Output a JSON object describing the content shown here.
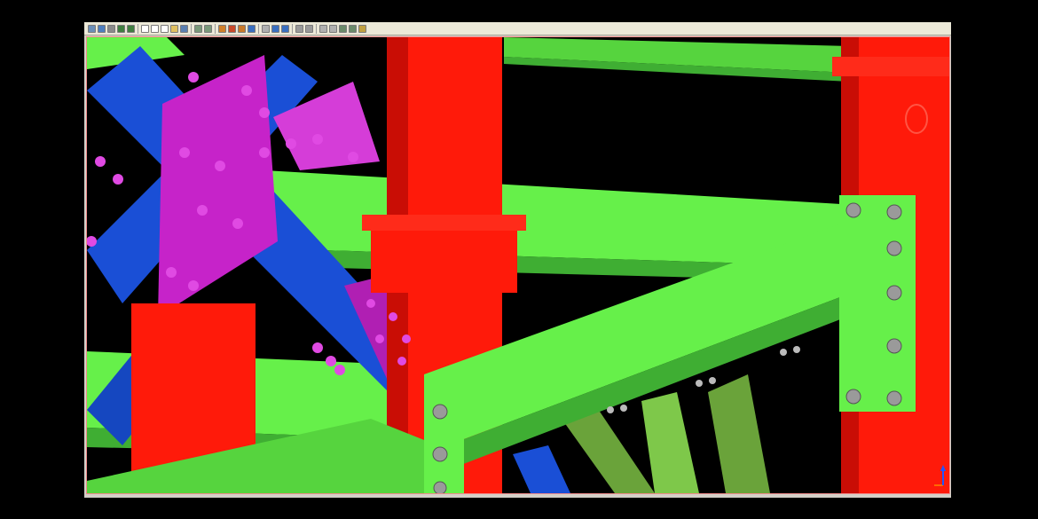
{
  "window": {
    "kind": "3D structural steel model viewer"
  },
  "toolbar": {
    "buttons": [
      {
        "icon": "open-icon",
        "color": "#6b8fb8"
      },
      {
        "icon": "save-icon",
        "color": "#4f7fbf"
      },
      {
        "icon": "print-icon",
        "color": "#8a8a8a"
      },
      {
        "icon": "undo-icon",
        "color": "#3f7f3f"
      },
      {
        "icon": "redo-icon",
        "color": "#3f7f3f"
      },
      {
        "sep": true
      },
      {
        "icon": "select-icon",
        "color": "#ffffff"
      },
      {
        "icon": "window-icon",
        "color": "#ffffff"
      },
      {
        "icon": "copy-icon",
        "color": "#ffffff"
      },
      {
        "icon": "paste-icon",
        "color": "#e0c060"
      },
      {
        "icon": "properties-icon",
        "color": "#5a7fb0"
      },
      {
        "sep": true
      },
      {
        "icon": "zoom-extents-icon",
        "color": "#7a9a7a"
      },
      {
        "icon": "zoom-window-icon",
        "color": "#7a9a7a"
      },
      {
        "sep": true
      },
      {
        "icon": "render-icon",
        "color": "#d0802a"
      },
      {
        "icon": "shade-icon",
        "color": "#c94a2a"
      },
      {
        "icon": "material-icon",
        "color": "#c97a2a"
      },
      {
        "icon": "light-icon",
        "color": "#3a6fbf"
      },
      {
        "sep": true
      },
      {
        "icon": "snap-icon",
        "color": "#b0b0b0"
      },
      {
        "icon": "grid-icon",
        "color": "#3a6fbf"
      },
      {
        "icon": "layer-icon",
        "color": "#3a6fbf"
      },
      {
        "sep": true
      },
      {
        "icon": "pan-icon",
        "color": "#9a9a9a"
      },
      {
        "icon": "rotate-icon",
        "color": "#9a9a9a"
      },
      {
        "sep": true
      },
      {
        "icon": "measure-icon",
        "color": "#b0b0b0"
      },
      {
        "icon": "dimension-icon",
        "color": "#b0b0b0"
      },
      {
        "icon": "section-icon",
        "color": "#6a8a6a"
      },
      {
        "icon": "clip-icon",
        "color": "#6a8a6a"
      },
      {
        "icon": "settings-icon",
        "color": "#c0a040"
      }
    ]
  },
  "viewport": {
    "colors": {
      "background": "#000000",
      "column_red": "#ff1a0a",
      "column_red_shade": "#c90d05",
      "beam_green": "#66f04a",
      "beam_green_dark": "#3fae33",
      "beam_green_mid": "#56d43e",
      "bracing_blue": "#1a4fd6",
      "gusset_magenta": "#c623c9",
      "bolt_gray": "#9a9a9a",
      "olive_brace": "#6aa33a"
    },
    "axis_icon": "axis-triad-icon"
  }
}
